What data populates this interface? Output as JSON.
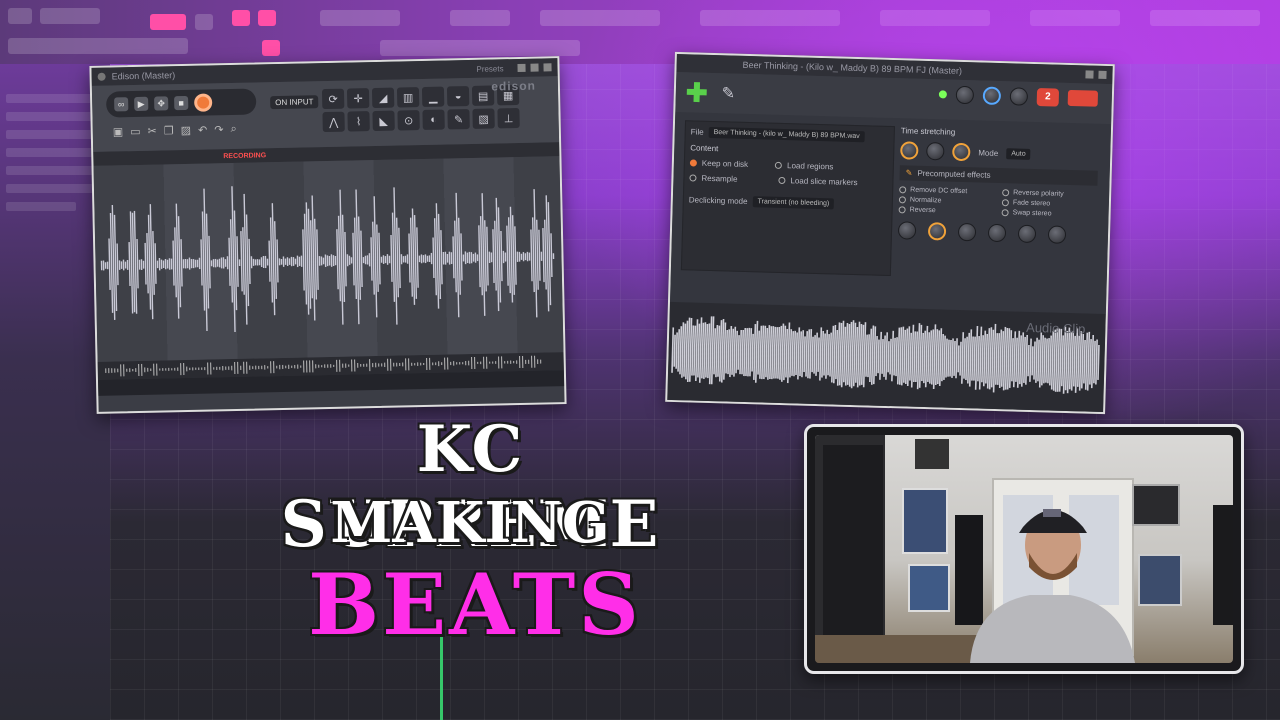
{
  "headline": {
    "line1": "KC SUPREME",
    "line2": "MAKING",
    "line3": "BEATS"
  },
  "edison": {
    "title": "Edison (Master)",
    "preset_label": "Presets",
    "input_label": "ON INPUT",
    "logo": "edison",
    "recording_label": "RECORDING"
  },
  "audio_clip": {
    "title": "Beer Thinking - (Kilo w_ Maddy B) 89 BPM FJ (Master)",
    "file_label": "File",
    "file_value": "Beer Thinking - (kilo w_ Maddy B) 89 BPM.wav",
    "content_label": "Content",
    "keep_on_disk": "Keep on disk",
    "resample": "Resample",
    "load_regions": "Load regions",
    "load_slice_markers": "Load slice markers",
    "declicking_label": "Declicking mode",
    "declicking_value": "Transient (no bleeding)",
    "time_stretching": "Time stretching",
    "mode_label": "Mode",
    "mode_value": "Auto",
    "precomputed_effects": "Precomputed effects",
    "effects": [
      "Remove DC offset",
      "Reverse polarity",
      "Normalize",
      "Fade stereo",
      "Reverse",
      "Swap stereo"
    ],
    "badge": "2",
    "waveform_label": "Audio Clip"
  },
  "colors": {
    "accent_purple": "#a33ed0",
    "headline_pink": "#ff2ee8",
    "record_orange": "#f07a3a",
    "plus_green": "#59d04b"
  }
}
